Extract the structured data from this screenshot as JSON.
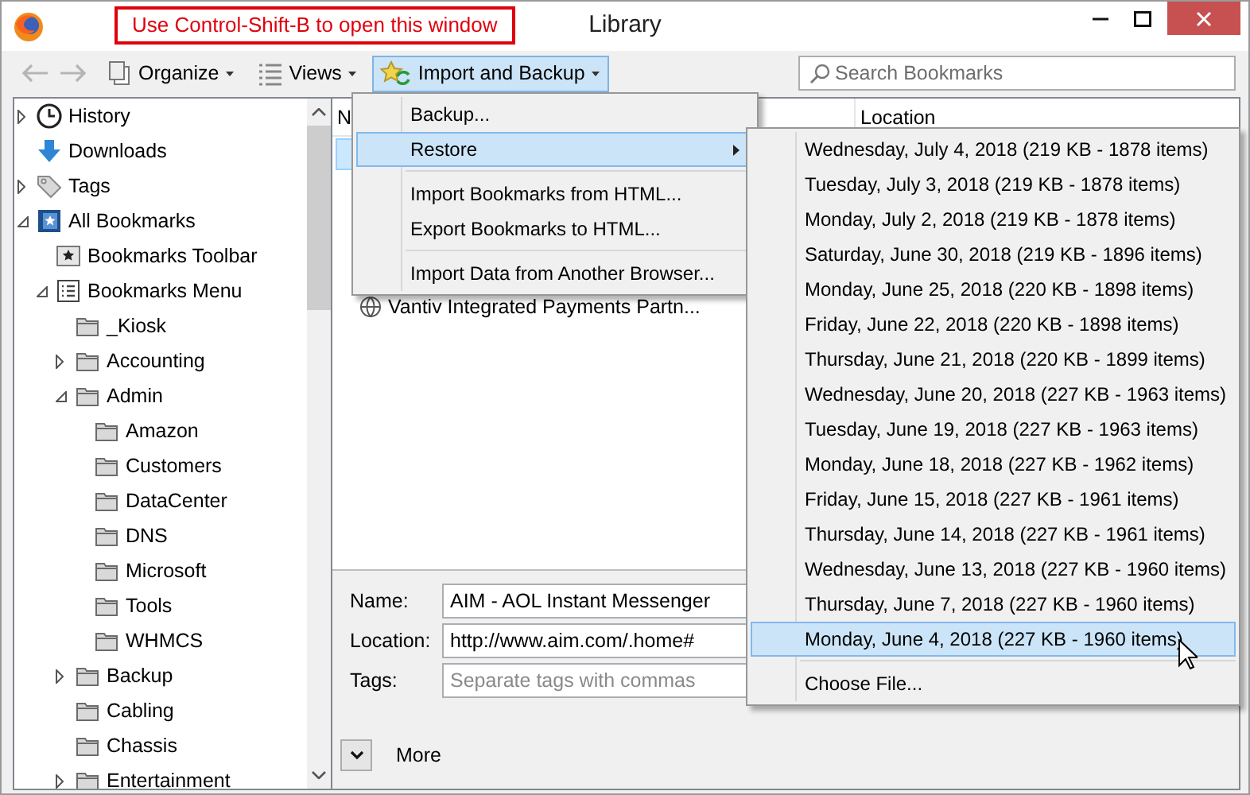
{
  "window": {
    "title": "Library",
    "annotation": "Use Control-Shift-B to open this window"
  },
  "toolbar": {
    "nav": [
      {
        "kind": "back",
        "disabled": true
      },
      {
        "kind": "forward",
        "disabled": true
      }
    ],
    "menus": [
      {
        "label": "Organize",
        "kind": "organize",
        "open": false
      },
      {
        "label": "Views",
        "kind": "views",
        "open": false
      },
      {
        "label": "Import and Backup",
        "kind": "import",
        "open": true
      }
    ],
    "search": {
      "placeholder": "Search Bookmarks"
    }
  },
  "sidebar": {
    "items": [
      {
        "label": "History",
        "kind": "clock",
        "expanded": false
      },
      {
        "label": "Downloads",
        "kind": "download"
      },
      {
        "label": "Tags",
        "kind": "tag",
        "expanded": false
      },
      {
        "label": "All Bookmarks",
        "kind": "library",
        "expanded": true,
        "children": [
          {
            "label": "Bookmarks Toolbar",
            "kind": "toolbar"
          },
          {
            "label": "Bookmarks Menu",
            "kind": "list",
            "expanded": true,
            "children": [
              {
                "label": "_Kiosk",
                "kind": "folder"
              },
              {
                "label": "Accounting",
                "kind": "folder",
                "expanded": false
              },
              {
                "label": "Admin",
                "kind": "folder",
                "expanded": true,
                "children": [
                  {
                    "label": "Amazon",
                    "kind": "folder"
                  },
                  {
                    "label": "Customers",
                    "kind": "folder"
                  },
                  {
                    "label": "DataCenter",
                    "kind": "folder"
                  },
                  {
                    "label": "DNS",
                    "kind": "folder"
                  },
                  {
                    "label": "Microsoft",
                    "kind": "folder"
                  },
                  {
                    "label": "Tools",
                    "kind": "folder"
                  },
                  {
                    "label": "WHMCS",
                    "kind": "folder"
                  }
                ]
              },
              {
                "label": "Backup",
                "kind": "folder",
                "expanded": false
              },
              {
                "label": "Cabling",
                "kind": "folder"
              },
              {
                "label": "Chassis",
                "kind": "folder"
              },
              {
                "label": "Entertainment",
                "kind": "folder",
                "expanded": false
              }
            ]
          }
        ]
      }
    ]
  },
  "table": {
    "columns": [
      "N",
      "Location"
    ],
    "rows": [
      {
        "selected": true
      },
      {
        "name": "Vantiv Integrated Payments Partn...",
        "selected": false
      }
    ]
  },
  "details": {
    "fields": [
      {
        "label": "Name:",
        "value": "AIM - AOL Instant Messenger"
      },
      {
        "label": "Location:",
        "value": "http://www.aim.com/.home#"
      },
      {
        "label": "Tags:",
        "placeholder": "Separate tags with commas"
      }
    ],
    "more": {
      "label": "More",
      "expanded": false
    }
  },
  "menu": {
    "items": [
      {
        "kind": "item",
        "label": "Backup...",
        "selected": false
      },
      {
        "kind": "submenu",
        "label": "Restore",
        "selected": true
      },
      {
        "kind": "separator"
      },
      {
        "kind": "item",
        "label": "Import Bookmarks from HTML...",
        "selected": false
      },
      {
        "kind": "item",
        "label": "Export Bookmarks to HTML...",
        "selected": false
      },
      {
        "kind": "separator"
      },
      {
        "kind": "item",
        "label": "Import Data from Another Browser...",
        "selected": false
      }
    ]
  },
  "submenu": {
    "items": [
      {
        "kind": "item",
        "label": "Wednesday, July 4, 2018 (219 KB - 1878 items)",
        "selected": false
      },
      {
        "kind": "item",
        "label": "Tuesday, July 3, 2018 (219 KB - 1878 items)",
        "selected": false
      },
      {
        "kind": "item",
        "label": "Monday, July 2, 2018 (219 KB - 1878 items)",
        "selected": false
      },
      {
        "kind": "item",
        "label": "Saturday, June 30, 2018 (219 KB - 1896 items)",
        "selected": false
      },
      {
        "kind": "item",
        "label": "Monday, June 25, 2018 (220 KB - 1898 items)",
        "selected": false
      },
      {
        "kind": "item",
        "label": "Friday, June 22, 2018 (220 KB - 1898 items)",
        "selected": false
      },
      {
        "kind": "item",
        "label": "Thursday, June 21, 2018 (220 KB - 1899 items)",
        "selected": false
      },
      {
        "kind": "item",
        "label": "Wednesday, June 20, 2018 (227 KB - 1963 items)",
        "selected": false
      },
      {
        "kind": "item",
        "label": "Tuesday, June 19, 2018 (227 KB - 1963 items)",
        "selected": false
      },
      {
        "kind": "item",
        "label": "Monday, June 18, 2018 (227 KB - 1962 items)",
        "selected": false
      },
      {
        "kind": "item",
        "label": "Friday, June 15, 2018 (227 KB - 1961 items)",
        "selected": false
      },
      {
        "kind": "item",
        "label": "Thursday, June 14, 2018 (227 KB - 1961 items)",
        "selected": false
      },
      {
        "kind": "item",
        "label": "Wednesday, June 13, 2018 (227 KB - 1960 items)",
        "selected": false
      },
      {
        "kind": "item",
        "label": "Thursday, June 7, 2018 (227 KB - 1960 items)",
        "selected": false
      },
      {
        "kind": "item",
        "label": "Monday, June 4, 2018 (227 KB - 1960 items)",
        "selected": true
      },
      {
        "kind": "separator"
      },
      {
        "kind": "item",
        "label": "Choose File...",
        "selected": false
      }
    ]
  }
}
